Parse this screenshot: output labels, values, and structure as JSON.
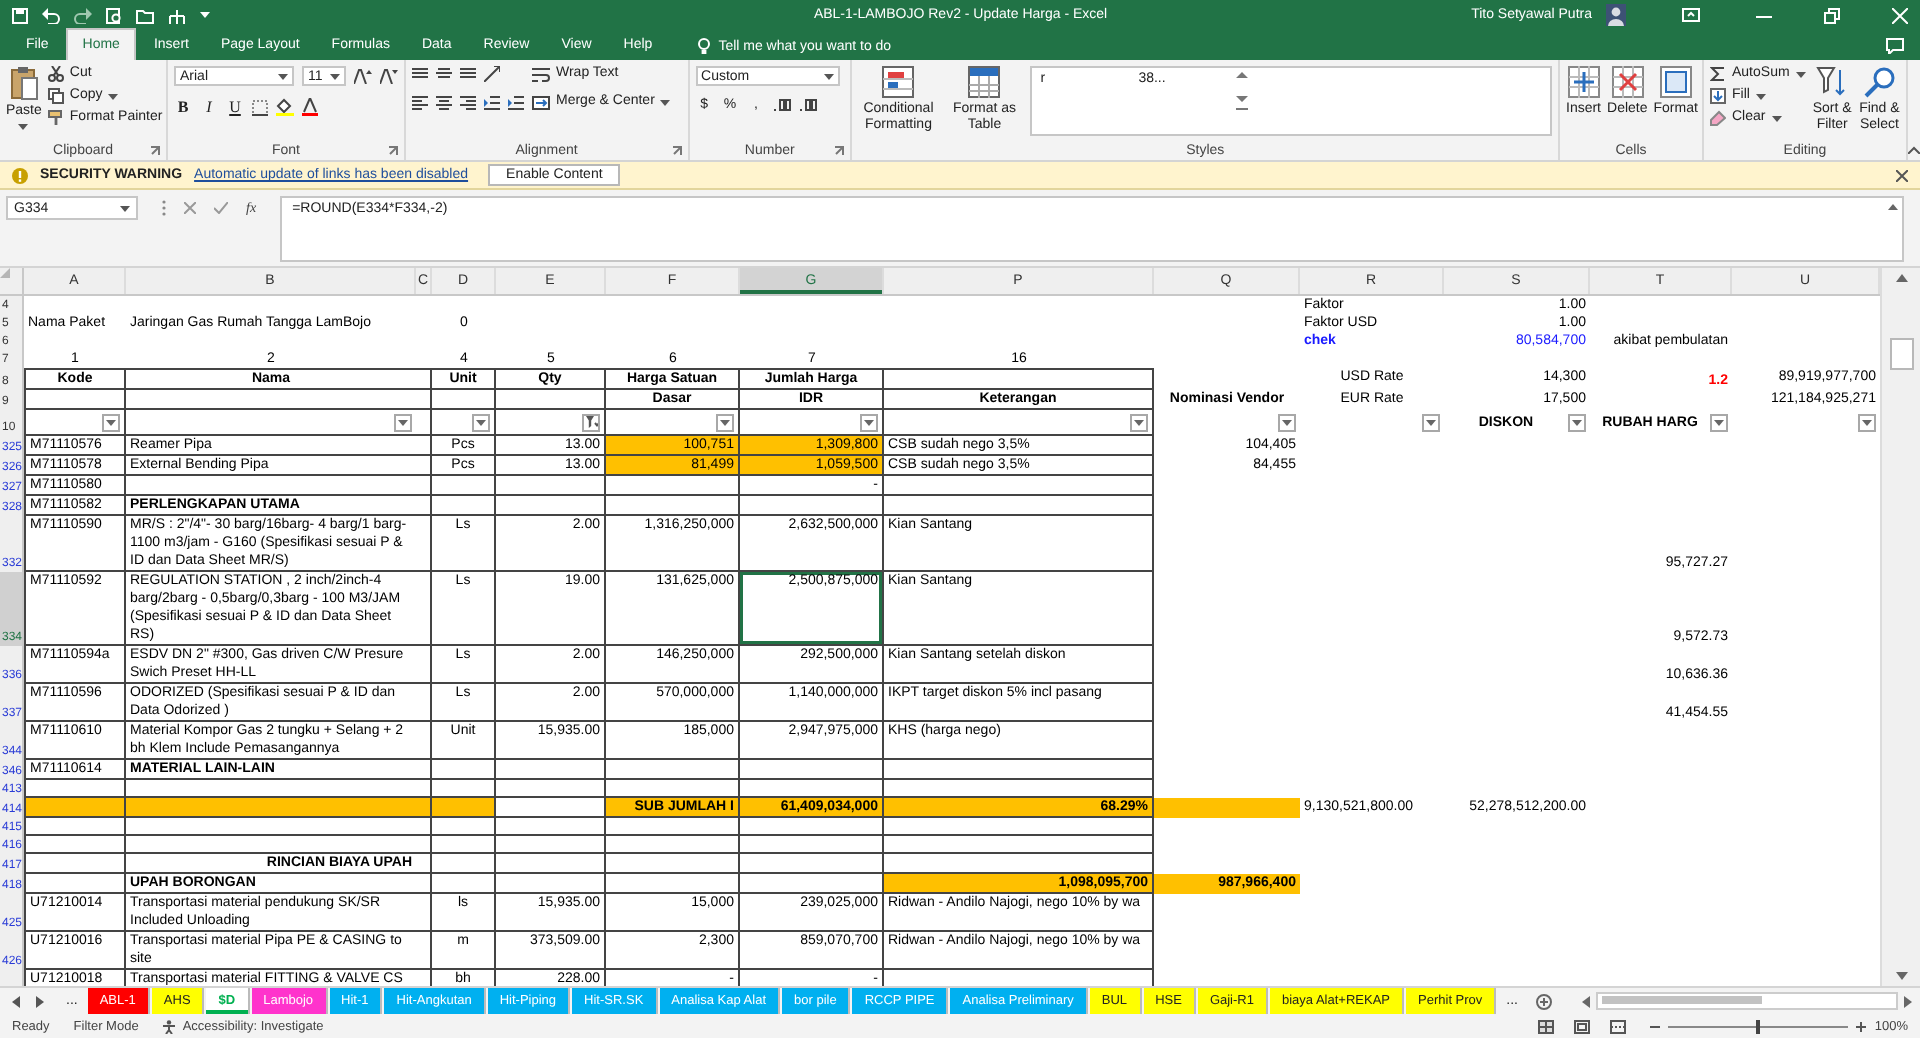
{
  "title_bar": {
    "title": "ABL-1-LAMBOJO Rev2 - Update Harga - Excel",
    "user": "Tito Setyawal Putra"
  },
  "ribbon_tabs": [
    {
      "label": "File",
      "selected": false
    },
    {
      "label": "Home",
      "selected": true
    },
    {
      "label": "Insert",
      "selected": false
    },
    {
      "label": "Page Layout",
      "selected": false
    },
    {
      "label": "Formulas",
      "selected": false
    },
    {
      "label": "Data",
      "selected": false
    },
    {
      "label": "Review",
      "selected": false
    },
    {
      "label": "View",
      "selected": false
    },
    {
      "label": "Help",
      "selected": false
    }
  ],
  "tell_me": "Tell me what you want to do",
  "ribbon": {
    "groups": [
      {
        "kind": "clipboard",
        "label": "Clipboard",
        "large": [
          "Paste"
        ],
        "small": [
          "Cut",
          "Copy",
          "Format Painter"
        ]
      },
      {
        "kind": "font",
        "label": "Font",
        "fields": [
          "Arial",
          "11"
        ],
        "toggles": [
          "B",
          "I",
          "U"
        ]
      },
      {
        "kind": "alignment",
        "label": "Alignment",
        "small": [
          "Wrap Text",
          "Merge & Center"
        ]
      },
      {
        "kind": "number",
        "label": "Number",
        "fields": [
          "Custom"
        ],
        "toggles": [
          "$",
          "%",
          ","
        ]
      },
      {
        "kind": "styles",
        "label": "Styles",
        "large": [
          "Conditional Formatting",
          "Format as Table"
        ],
        "gallery": [
          "r",
          "38..."
        ]
      },
      {
        "kind": "cells",
        "label": "Cells",
        "large": [
          "Insert",
          "Delete",
          "Format"
        ]
      },
      {
        "kind": "editing",
        "label": "Editing",
        "small": [
          "AutoSum",
          "Fill",
          "Clear"
        ],
        "large": [
          "Sort & Filter",
          "Find & Select"
        ]
      }
    ]
  },
  "warning_bar": {
    "title": "SECURITY WARNING",
    "message": "Automatic update of links has been disabled",
    "button": "Enable Content"
  },
  "formula_bar": {
    "name_box": "G334",
    "function_label": "fx",
    "formula": "=ROUND(E334*F334,-2)"
  },
  "sheet": {
    "columns": [
      {
        "label": "A",
        "selected": false
      },
      {
        "label": "B",
        "selected": false
      },
      {
        "label": "C",
        "selected": false
      },
      {
        "label": "D",
        "selected": false
      },
      {
        "label": "E",
        "selected": false
      },
      {
        "label": "F",
        "selected": false
      },
      {
        "label": "G",
        "selected": true
      },
      {
        "label": "P",
        "selected": false
      },
      {
        "label": "Q",
        "selected": false
      },
      {
        "label": "R",
        "selected": false
      },
      {
        "label": "S",
        "selected": false
      },
      {
        "label": "T",
        "selected": false
      },
      {
        "label": "U",
        "selected": false
      }
    ],
    "rows": [
      {
        "number": "4",
        "kind": "meta",
        "selected": false,
        "filtered": false,
        "cells": {
          "R": "Faktor",
          "S": "1.00"
        }
      },
      {
        "number": "5",
        "kind": "meta",
        "selected": false,
        "filtered": false,
        "cells": {
          "A": "Nama Paket",
          "B": "Jaringan Gas Rumah Tangga LamBojo",
          "D": "0",
          "R": "Faktor USD",
          "S": "1.00"
        }
      },
      {
        "number": "6",
        "kind": "meta",
        "selected": false,
        "filtered": false,
        "cells": {
          "R": {
            "text": "chek",
            "bold": true,
            "color": "#1a1aff"
          },
          "S": {
            "text": "80,584,700",
            "color": "#1a1aff"
          },
          "T": "akibat pembulatan"
        }
      },
      {
        "number": "7",
        "kind": "numbering",
        "selected": false,
        "filtered": false,
        "cells": {
          "A": "1",
          "B": "2",
          "D": "4",
          "E": "5",
          "F": "6",
          "G": "7",
          "P": "16"
        }
      },
      {
        "number": "8",
        "kind": "header",
        "selected": false,
        "filtered": false,
        "cells": {
          "A": {
            "text": "Kode",
            "bold": true
          },
          "B": {
            "text": "Nama",
            "bold": true
          },
          "D": {
            "text": "Unit",
            "bold": true
          },
          "E": {
            "text": "Qty",
            "bold": true
          },
          "F": {
            "text": "Harga Satuan",
            "bold": true
          },
          "G": {
            "text": "Jumlah Harga",
            "bold": true
          },
          "R": "USD Rate",
          "S": "14,300",
          "T": {
            "text": "1.2",
            "bold": true,
            "color": "#ff0000"
          },
          "U": "89,919,977,700"
        }
      },
      {
        "number": "9",
        "kind": "header",
        "selected": false,
        "filtered": false,
        "cells": {
          "F": {
            "text": "Dasar",
            "bold": true
          },
          "G": {
            "text": "IDR",
            "bold": true
          },
          "P": {
            "text": "Keterangan",
            "bold": true
          },
          "Q": {
            "text": "Nominasi Vendor",
            "bold": true
          },
          "R": "EUR Rate",
          "S": "17,500",
          "U": "121,184,925,271"
        }
      },
      {
        "number": "10",
        "kind": "filter",
        "selected": false,
        "filtered": false,
        "cells": {
          "A": {
            "filtered": false
          },
          "B": {
            "filtered": false
          },
          "D": {
            "filtered": false
          },
          "E": {
            "filtered": true
          },
          "F": {
            "filtered": false
          },
          "G": {
            "filtered": false
          },
          "P": {
            "filtered": false
          },
          "Q": {
            "filtered": false
          },
          "R": {
            "filtered": false
          },
          "S": {
            "text": "DISKON",
            "bold": true,
            "filtered": false
          },
          "T": {
            "text": "RUBAH HARG",
            "bold": true,
            "filtered": false
          },
          "U": {
            "filtered": false
          }
        }
      },
      {
        "number": "325",
        "kind": "plain",
        "selected": false,
        "filtered": true,
        "cells": {
          "A": "M71110576",
          "B": "Reamer Pipa",
          "D": "Pcs",
          "E": "13.00",
          "F": {
            "text": "100,751",
            "highlighted": true
          },
          "G": {
            "text": "1,309,800",
            "highlighted": true
          },
          "P": "CSB sudah nego 3,5%",
          "Q": "104,405"
        }
      },
      {
        "number": "326",
        "kind": "plain",
        "selected": false,
        "filtered": true,
        "cells": {
          "A": "M71110578",
          "B": "External Bending Pipa",
          "D": "Pcs",
          "E": "13.00",
          "F": {
            "text": "81,499",
            "highlighted": true
          },
          "G": {
            "text": "1,059,500",
            "highlighted": true
          },
          "P": "CSB sudah nego 3,5%",
          "Q": "84,455"
        }
      },
      {
        "number": "327",
        "kind": "plain",
        "selected": false,
        "filtered": true,
        "cells": {
          "A": "M71110580",
          "G": "-"
        }
      },
      {
        "number": "328",
        "kind": "plain",
        "selected": false,
        "filtered": true,
        "cells": {
          "A": "M71110582",
          "B": {
            "text": "PERLENGKAPAN UTAMA",
            "bold": true
          }
        }
      },
      {
        "number": "332",
        "kind": "plain",
        "selected": false,
        "filtered": true,
        "cells": {
          "A": "M71110590",
          "B": "MR/S : 2\"/4\"- 30 barg/16barg- 4 barg/1 barg-1100 m3/jam - G160 (Spesifikasi sesuai P & ID dan Data Sheet MR/S)",
          "D": "Ls",
          "E": "2.00",
          "F": "1,316,250,000",
          "G": "2,632,500,000",
          "P": "Kian Santang",
          "T": "95,727.27"
        }
      },
      {
        "number": "334",
        "kind": "plain",
        "selected": true,
        "filtered": true,
        "cells": {
          "A": "M71110592",
          "B": "REGULATION STATION , 2 inch/2inch-4 barg/2barg - 0,5barg/0,3barg - 100 M3/JAM (Spesifikasi sesuai P & ID dan Data Sheet RS)",
          "D": "Ls",
          "E": "19.00",
          "F": "131,625,000",
          "G": "2,500,875,000",
          "P": "Kian Santang",
          "T": "9,572.73"
        }
      },
      {
        "number": "336",
        "kind": "plain",
        "selected": false,
        "filtered": true,
        "cells": {
          "A": "M71110594a",
          "B": "ESDV DN 2\" #300, Gas driven C/W Presure Swich Preset HH-LL",
          "D": "Ls",
          "E": "2.00",
          "F": "146,250,000",
          "G": "292,500,000",
          "P": "Kian Santang setelah diskon",
          "T": "10,636.36"
        }
      },
      {
        "number": "337",
        "kind": "plain",
        "selected": false,
        "filtered": true,
        "cells": {
          "A": "M71110596",
          "B": "ODORIZED (Spesifikasi sesuai P & ID dan Data Odorized )",
          "D": "Ls",
          "E": "2.00",
          "F": "570,000,000",
          "G": "1,140,000,000",
          "P": "IKPT target diskon 5% incl pasang",
          "T": "41,454.55"
        }
      },
      {
        "number": "344",
        "kind": "plain",
        "selected": false,
        "filtered": true,
        "cells": {
          "A": "M71110610",
          "B": "Material Kompor Gas 2 tungku + Selang + 2 bh Klem Include Pemasangannya",
          "D": "Unit",
          "E": "15,935.00",
          "F": "185,000",
          "G": "2,947,975,000",
          "P": "KHS (harga nego)"
        }
      },
      {
        "number": "346",
        "kind": "plain",
        "selected": false,
        "filtered": true,
        "cells": {
          "A": "M71110614",
          "B": {
            "text": "MATERIAL LAIN-LAIN",
            "bold": true
          }
        }
      },
      {
        "number": "413",
        "kind": "plain",
        "selected": false,
        "filtered": true,
        "cells": {}
      },
      {
        "number": "414",
        "kind": "total",
        "selected": false,
        "filtered": true,
        "cells": {
          "A": {
            "highlighted": true
          },
          "B": {
            "highlighted": true
          },
          "C": {
            "highlighted": true
          },
          "D": {
            "highlighted": true
          },
          "F": {
            "text": "SUB JUMLAH I",
            "bold": true,
            "highlighted": true
          },
          "G": {
            "text": "61,409,034,000",
            "bold": true,
            "highlighted": true
          },
          "P": {
            "text": "68.29%",
            "bold": true,
            "highlighted": true
          },
          "Q": {
            "highlighted": true
          },
          "R": "9,130,521,800.00",
          "S": "52,278,512,200.00"
        }
      },
      {
        "number": "415",
        "kind": "plain",
        "selected": false,
        "filtered": true,
        "cells": {}
      },
      {
        "number": "416",
        "kind": "plain",
        "selected": false,
        "filtered": true,
        "cells": {}
      },
      {
        "number": "417",
        "kind": "section",
        "selected": false,
        "filtered": true,
        "cells": {
          "B": {
            "text": "RINCIAN BIAYA UPAH",
            "bold": true
          }
        }
      },
      {
        "number": "418",
        "kind": "total",
        "selected": false,
        "filtered": true,
        "cells": {
          "B": {
            "text": "UPAH BORONGAN",
            "bold": true
          },
          "P": {
            "text": "1,098,095,700",
            "bold": true,
            "highlighted": true
          },
          "Q": {
            "text": "987,966,400",
            "bold": true,
            "highlighted": true
          }
        }
      },
      {
        "number": "425",
        "kind": "plain",
        "selected": false,
        "filtered": true,
        "cells": {
          "A": "U71210014",
          "B": "Transportasi material pendukung SK/SR Included Unloading",
          "D": "ls",
          "E": "15,935.00",
          "F": "15,000",
          "G": "239,025,000",
          "P": "Ridwan - Andilo Najogi, nego 10% by wa"
        }
      },
      {
        "number": "426",
        "kind": "plain",
        "selected": false,
        "filtered": true,
        "cells": {
          "A": "U71210016",
          "B": "Transportasi material Pipa PE & CASING to site",
          "D": "m",
          "E": "373,509.00",
          "F": "2,300",
          "G": "859,070,700",
          "P": "Ridwan - Andilo Najogi, nego 10% by wa"
        }
      },
      {
        "kind": "plain",
        "selected": false,
        "cells": {
          "A": "U71210018",
          "B": "Transportasi material FITTING & VALVE CS",
          "D": "bh",
          "E": "228.00",
          "F": "-",
          "G": "-"
        }
      }
    ]
  },
  "sheet_tabs": {
    "overflow_left": "...",
    "overflow_right": "...",
    "tabs": [
      {
        "label": "ABL-1",
        "color": "#ff0000",
        "selected": false
      },
      {
        "label": "AHS",
        "color": "#ffff00",
        "selected": false
      },
      {
        "label": "$D",
        "color": "#00b050",
        "selected": true
      },
      {
        "label": "Lambojo",
        "color": "#ff33cc",
        "selected": false
      },
      {
        "label": "Hit-1",
        "color": "#00b0f0",
        "selected": false
      },
      {
        "label": "Hit-Angkutan",
        "color": "#00b0f0",
        "selected": false
      },
      {
        "label": "Hit-Piping",
        "color": "#00b0f0",
        "selected": false
      },
      {
        "label": "Hit-SR.SK",
        "color": "#00b0f0",
        "selected": false
      },
      {
        "label": "Analisa Kap Alat",
        "color": "#00b0f0",
        "selected": false
      },
      {
        "label": "bor pile",
        "color": "#00b0f0",
        "selected": false
      },
      {
        "label": "RCCP PIPE",
        "color": "#00b0f0",
        "selected": false
      },
      {
        "label": "Analisa Preliminary",
        "color": "#00b0f0",
        "selected": false
      },
      {
        "label": "BUL",
        "color": "#ffff00",
        "selected": false
      },
      {
        "label": "HSE",
        "color": "#ffff00",
        "selected": false
      },
      {
        "label": "Gaji-R1",
        "color": "#ffff00",
        "selected": false
      },
      {
        "label": "biaya Alat+REKAP",
        "color": "#ffff00",
        "selected": false
      },
      {
        "label": "Perhit Prov",
        "color": "#ffff00",
        "selected": false
      }
    ]
  },
  "status_bar": {
    "mode": "Ready",
    "filter": "Filter Mode",
    "accessibility": "Accessibility: Investigate",
    "zoom": "100%",
    "zoom_slider": {
      "level": 0.5
    }
  }
}
